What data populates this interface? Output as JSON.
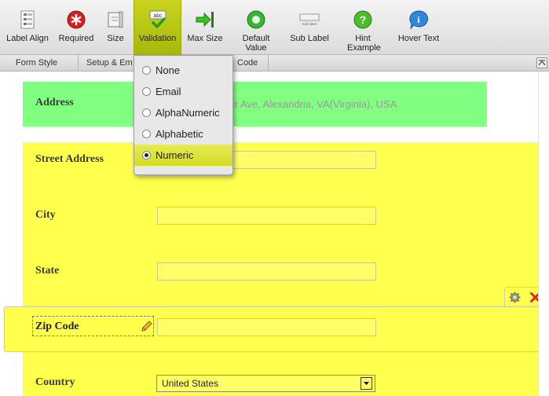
{
  "toolbar": {
    "buttons": [
      {
        "label": "Label Align",
        "icon": "label-align-icon"
      },
      {
        "label": "Required",
        "icon": "required-icon"
      },
      {
        "label": "Size",
        "icon": "size-icon"
      },
      {
        "label": "Validation",
        "icon": "validation-icon",
        "active": true
      },
      {
        "label": "Max Size",
        "icon": "max-size-icon"
      },
      {
        "label": "Default Value",
        "icon": "default-value-icon"
      },
      {
        "label": "Sub Label",
        "icon": "sub-label-icon"
      },
      {
        "label": "Hint Example",
        "icon": "hint-icon"
      },
      {
        "label": "Hover Text",
        "icon": "info-icon"
      }
    ],
    "validation_badge": "abc",
    "sub_label_badge": "sub label"
  },
  "tabs": [
    "Form Style",
    "Setup & Em",
    "Code"
  ],
  "validation_menu": {
    "options": [
      "None",
      "Email",
      "AlphaNumeric",
      "Alphabetic",
      "Numeric"
    ],
    "selected": "Numeric"
  },
  "form": {
    "address": {
      "label": "Address",
      "placeholder": "ver Ave, Alexandria, VA(Virginia), USA"
    },
    "street": {
      "label": "Street Address"
    },
    "city": {
      "label": "City"
    },
    "state": {
      "label": "State"
    },
    "zip": {
      "label": "Zip Code"
    },
    "country": {
      "label": "Country",
      "value": "United States"
    }
  },
  "colors": {
    "accent_active": "#b8c614",
    "address_bg": "#80ff80",
    "section_bg": "#ffff4d",
    "delete": "#e0262b"
  }
}
